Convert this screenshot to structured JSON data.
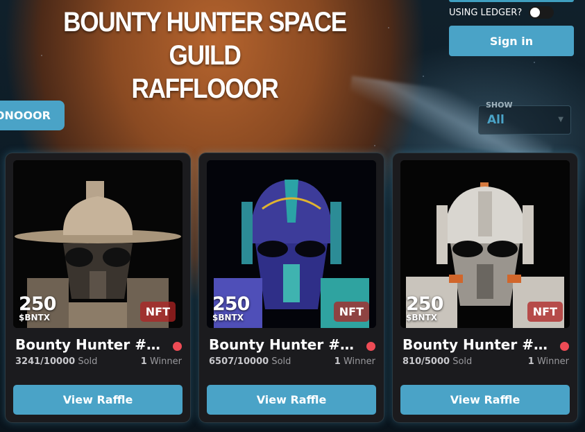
{
  "header": {
    "title_line1": "BOUNTY HUNTER SPACE GUILD",
    "title_line2": "RAFFLOOOR",
    "ledger_label": "USING LEDGER?",
    "ledger_enabled": false,
    "signin_label": "Sign in"
  },
  "filters": {
    "pill_label": "ONOOOR",
    "show_label": "SHOW",
    "show_value": "All"
  },
  "colors": {
    "accent": "#4aa3c7",
    "badge": "#af2323",
    "live_dot": "#ee4b55"
  },
  "cards": [
    {
      "price": "250",
      "currency": "$BNTX",
      "badge": "NFT",
      "name": "Bounty Hunter #4...",
      "sold": "3241/10000",
      "sold_label": "Sold",
      "winners": "1",
      "winners_label": "Winner",
      "button": "View Raffle"
    },
    {
      "price": "250",
      "currency": "$BNTX",
      "badge": "NFT",
      "name": "Bounty Hunter #4...",
      "sold": "6507/10000",
      "sold_label": "Sold",
      "winners": "1",
      "winners_label": "Winner",
      "button": "View Raffle"
    },
    {
      "price": "250",
      "currency": "$BNTX",
      "badge": "NFT",
      "name": "Bounty Hunter #4...",
      "sold": "810/5000",
      "sold_label": "Sold",
      "winners": "1",
      "winners_label": "Winner",
      "button": "View Raffle"
    }
  ]
}
